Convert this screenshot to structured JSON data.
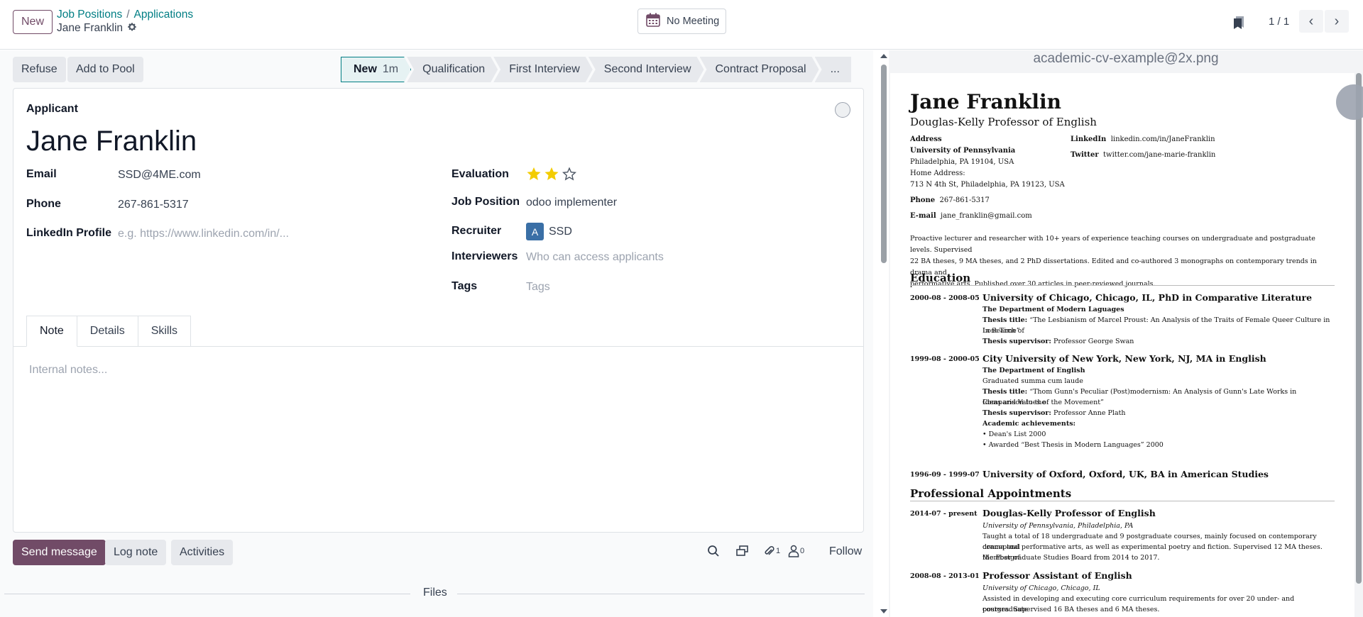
{
  "topbar": {
    "new_label": "New",
    "breadcrumb": [
      "Job Positions",
      "Applications"
    ],
    "breadcrumb_sep": "/",
    "record_name": "Jane Franklin",
    "meeting_label": "No Meeting",
    "pager_value": "1 / 1"
  },
  "actions": {
    "refuse": "Refuse",
    "add_to_pool": "Add to Pool"
  },
  "stages": [
    {
      "label": "New",
      "duration": "1m",
      "active": true
    },
    {
      "label": "Qualification"
    },
    {
      "label": "First Interview"
    },
    {
      "label": "Second Interview"
    },
    {
      "label": "Contract Proposal"
    },
    {
      "label": "..."
    }
  ],
  "form": {
    "applicant_label": "Applicant",
    "name": "Jane Franklin",
    "email_label": "Email",
    "email": "SSD@4ME.com",
    "phone_label": "Phone",
    "phone": "267-861-5317",
    "linkedin_label": "LinkedIn Profile",
    "linkedin_placeholder": "e.g. https://www.linkedin.com/in/...",
    "evaluation_label": "Evaluation",
    "evaluation_stars": 2,
    "evaluation_max": 3,
    "job_position_label": "Job Position",
    "job_position": "odoo implementer",
    "recruiter_label": "Recruiter",
    "recruiter_initial": "A",
    "recruiter": "SSD",
    "interviewers_label": "Interviewers",
    "interviewers_placeholder": "Who can access applicants",
    "tags_label": "Tags",
    "tags_placeholder": "Tags",
    "tabs": [
      "Note",
      "Details",
      "Skills"
    ],
    "notes_placeholder": "Internal notes..."
  },
  "chatter": {
    "send_message": "Send message",
    "log_note": "Log note",
    "activities": "Activities",
    "attachments_count": "1",
    "followers_count": "0",
    "follow": "Follow",
    "files_label": "Files"
  },
  "preview": {
    "filename": "academic-cv-example@2x.png",
    "cv": {
      "name": "Jane Franklin",
      "title": "Douglas-Kelly Professor of English",
      "address_label": "Address",
      "address_org": "University of Pennsylvania",
      "address_city": "Philadelphia, PA 19104, USA",
      "home_label": "Home Address:",
      "home_address": "713 N 4th St, Philadelphia, PA 19123, USA",
      "phone_label": "Phone",
      "phone": "267-861-5317",
      "email_label": "E-mail",
      "email": "jane_franklin@gmail.com",
      "linkedin_label": "LinkedIn",
      "linkedin": "linkedin.com/in/JaneFranklin",
      "twitter_label": "Twitter",
      "twitter": "twitter.com/jane-marie-franklin",
      "summary": [
        "Proactive lecturer and researcher with 10+ years of experience teaching courses on undergraduate and postgraduate levels. Supervised",
        "22 BA theses, 9 MA theses, and 2 PhD dissertations. Edited and co-authored 3 monographs on contemporary trends in drama and",
        "performative arts. Published over 30 articles in peer-reviewed journals."
      ],
      "education_heading": "Education",
      "edu1_date": "2000-08 - 2008-05",
      "edu1_title": "University of Chicago, Chicago, IL, PhD in Comparative Literature",
      "edu1_dept": "The Department of Modern Laguages",
      "edu1_thesis_label": "Thesis title:",
      "edu1_thesis": "“The Lesbianism of Marcel Proust: An Analysis of the Traits of Female Queer Culture in In Search of",
      "edu1_thesis2": "Lost Time”",
      "edu1_sup_label": "Thesis supervisor:",
      "edu1_sup": "Professor George Swan",
      "edu2_date": "1999-08 - 2000-05",
      "edu2_title": "City University of New York, New York, NJ, MA in English",
      "edu2_dept": "The Department of English",
      "edu2_honor": "Graduated summa cum laude",
      "edu2_thesis_label": "Thesis title:",
      "edu2_thesis": "“Thom Gunn's Peculiar (Post)modernism: An Analysis of Gunn's Late Works in Comparison to the",
      "edu2_thesis2": "Ideas and Values of the Movement”",
      "edu2_sup_label": "Thesis supervisor:",
      "edu2_sup": "Professor Anne Plath",
      "edu2_ach_label": "Academic achievements:",
      "edu2_ach1": "•  Dean's List 2000",
      "edu2_ach2": "•  Awarded “Best Thesis in Modern Languages” 2000",
      "edu3_date": "1996-09 - 1999-07",
      "edu3_title": "University of Oxford, Oxford, UK, BA in American Studies",
      "prof_heading": "Professional Appointments",
      "job1_date": "2014-07 - present",
      "job1_title": "Douglas-Kelly Professor of English",
      "job1_org": "University of Pennsylvania, Philadelphia, PA",
      "job1_desc1": "Taught a total of 18 undergraduate and 9 postgraduate courses, mainly focused on contemporary conceptual",
      "job1_desc2": "drama and performative arts, as well as experimental poetry and fiction. Supervised 12 MA theses. Member of",
      "job1_desc3": "the Postgraduate Studies Board from 2014 to 2017.",
      "job2_date": "2008-08 - 2013-01",
      "job2_title": "Professor Assistant of English",
      "job2_org": "University of Chicago, Chicago, IL",
      "job2_desc1": "Assisted in developing and executing core curriculum requirements for over 20 under- and postgraduate",
      "job2_desc2": "courses. Supervised 16 BA theses and 6 MA theses."
    }
  },
  "colors": {
    "brand": "#714b67",
    "link": "#017e84",
    "star": "#f3cc00"
  }
}
